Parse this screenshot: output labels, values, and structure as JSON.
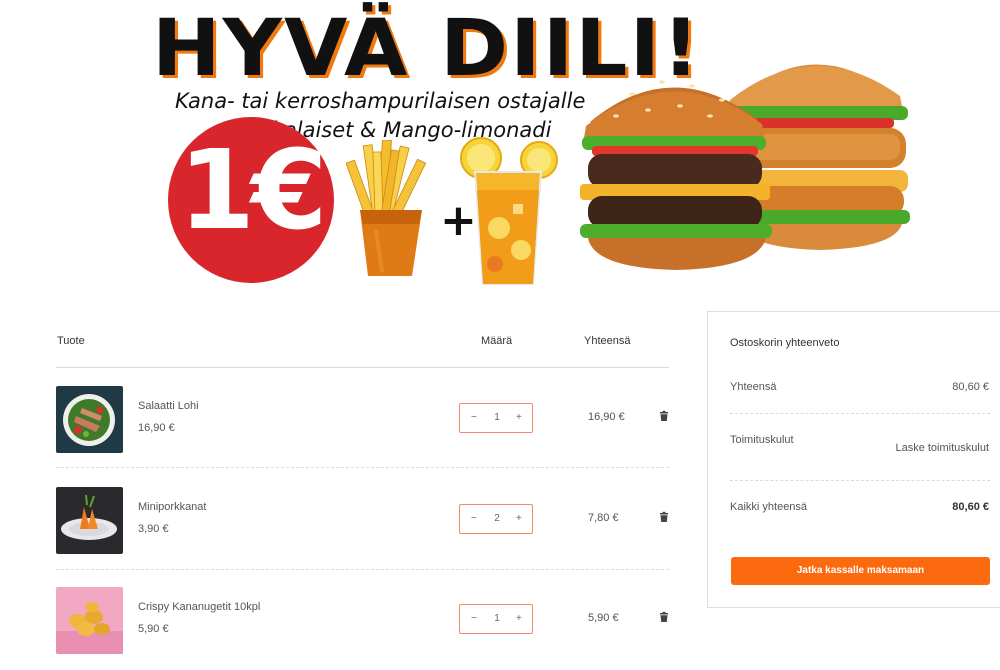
{
  "banner": {
    "headline": "HYVÄ DIILI!",
    "subline1": "Kana- tai kerroshampurilaisen ostajalle",
    "subline2": "Ranskalaiset & Mango-limonadi",
    "price": "1€",
    "plus": "+",
    "accent_color": "#d8262c"
  },
  "table": {
    "headers": {
      "product": "Tuote",
      "quantity": "Määrä",
      "total": "Yhteensä"
    },
    "rows": [
      {
        "name": "Salaatti Lohi",
        "price": "16,90 €",
        "quantity": "1",
        "total": "16,90 €",
        "minus": "−",
        "plus": "+",
        "thumb_icon": "salad-image"
      },
      {
        "name": "Miniporkkanat",
        "price": "3,90 €",
        "quantity": "2",
        "total": "7,80 €",
        "minus": "−",
        "plus": "+",
        "thumb_icon": "carrots-image"
      },
      {
        "name": "Crispy Kananugetit 10kpl",
        "price": "5,90 €",
        "quantity": "1",
        "total": "5,90 €",
        "minus": "−",
        "plus": "+",
        "thumb_icon": "nuggets-image"
      }
    ]
  },
  "summary": {
    "title": "Ostoskorin yhteenveto",
    "subtotal_label": "Yhteensä",
    "subtotal_value": "80,60 €",
    "shipping_label": "Toimituskulut",
    "shipping_value": "Laske toimituskulut",
    "grand_total_label": "Kaikki yhteensä",
    "grand_total_value": "80,60 €",
    "checkout_label": "Jatka kassalle maksamaan",
    "button_color": "#fb6a0e"
  }
}
